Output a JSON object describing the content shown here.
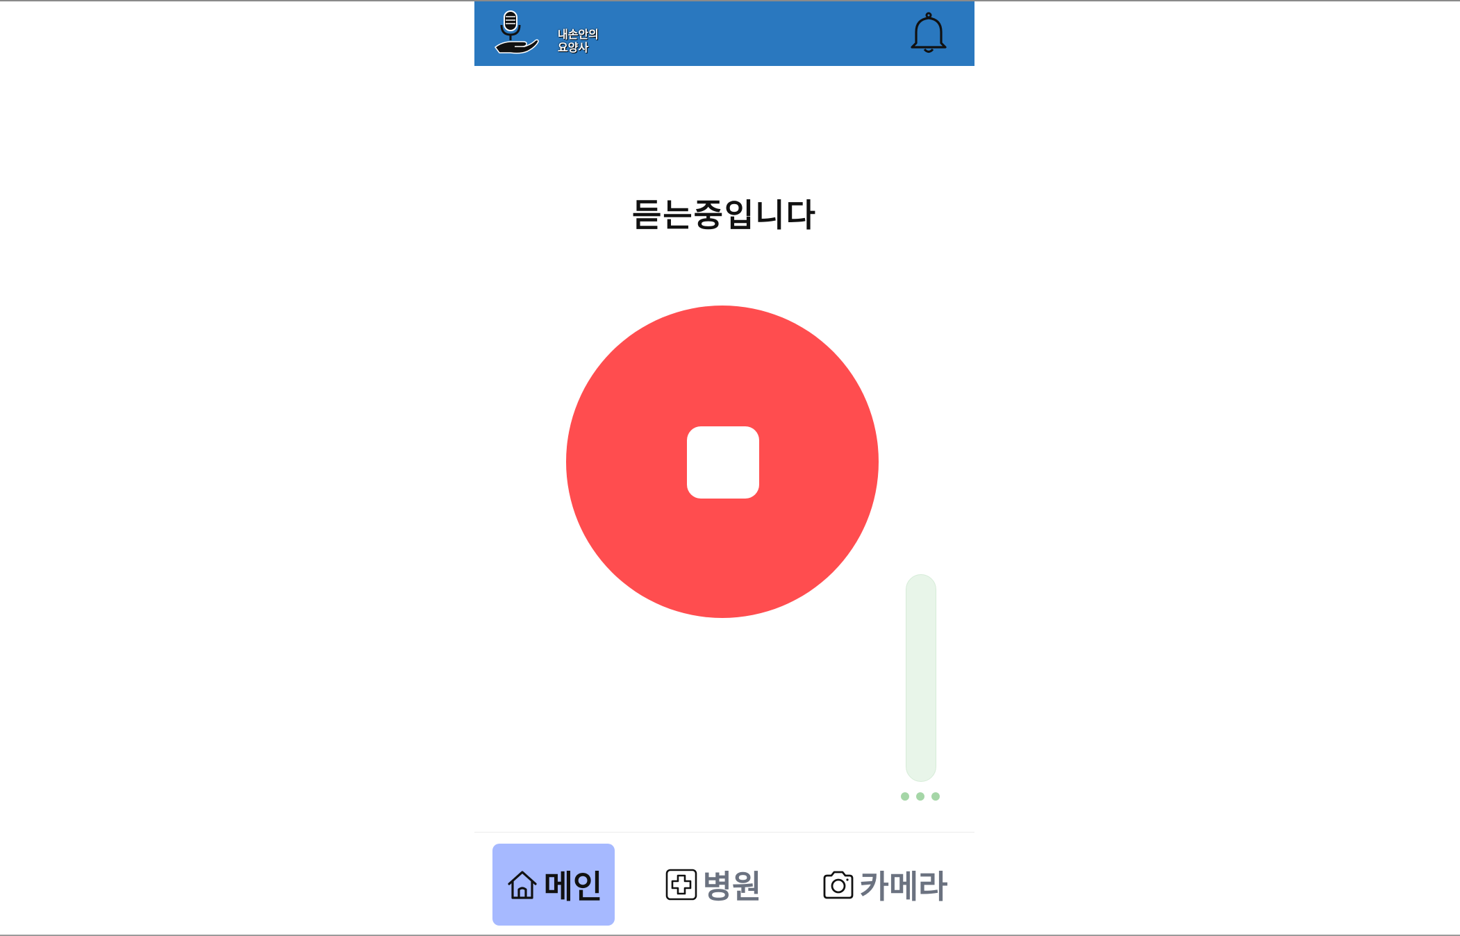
{
  "app": {
    "logo_text": "내손안의\n요양사"
  },
  "main": {
    "status_text": "듣는중입니다",
    "recording": true,
    "audio_level": 0.0
  },
  "nav": {
    "items": [
      {
        "label": "메인",
        "icon": "home-icon",
        "active": true
      },
      {
        "label": "병원",
        "icon": "hospital-plus-icon",
        "active": false
      },
      {
        "label": "카메라",
        "icon": "camera-icon",
        "active": false
      }
    ]
  },
  "colors": {
    "header": "#2a78bf",
    "record_button": "#ff4d4f",
    "active_tab": "#a6b9ff",
    "level_meter": "#e8f5e9",
    "level_dots": "#a5d6a7"
  }
}
